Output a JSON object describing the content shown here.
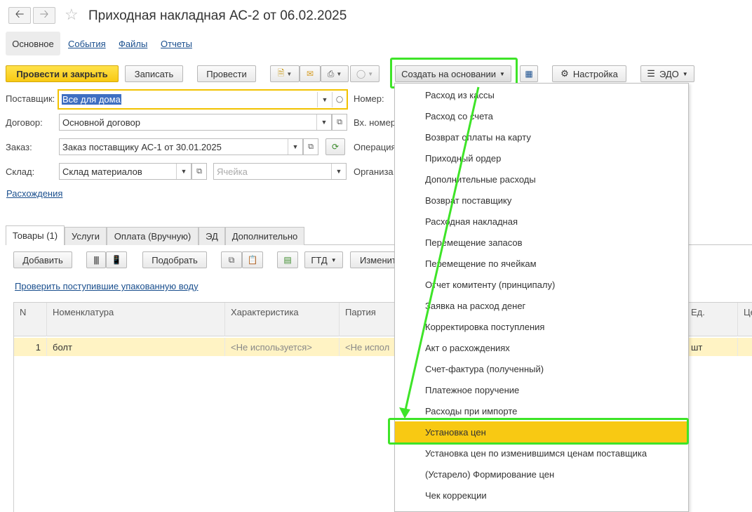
{
  "window": {
    "title": "Приходная накладная АС-2 от 06.02.2025"
  },
  "nav": {
    "back_icon": "arrow-left-icon",
    "forward_icon": "arrow-right-icon",
    "star_icon": "star-icon"
  },
  "top_tabs": [
    {
      "label": "Основное",
      "active": true
    },
    {
      "label": "События"
    },
    {
      "label": "Файлы"
    },
    {
      "label": "Отчеты"
    }
  ],
  "toolbar": {
    "post_close": "Провести и закрыть",
    "save": "Записать",
    "post": "Провести",
    "create_based": "Создать на основании",
    "settings": "Настройка",
    "edo": "ЭДО"
  },
  "form": {
    "supplier_label": "Поставщик:",
    "supplier_value": "Все для дома",
    "contract_label": "Договор:",
    "contract_value": "Основной договор",
    "order_label": "Заказ:",
    "order_value": "Заказ поставщику АС-1 от 30.01.2025",
    "warehouse_label": "Склад:",
    "warehouse_value": "Склад материалов",
    "cell_placeholder": "Ячейка",
    "number_label": "Номер:",
    "incoming_number_label": "Вх. номер",
    "operation_label": "Операция",
    "organization_label": "Организа",
    "discrepancies_link": "Расхождения"
  },
  "lower_tabs": [
    {
      "label": "Товары (1)",
      "active": true
    },
    {
      "label": "Услуги"
    },
    {
      "label": "Оплата (Вручную)"
    },
    {
      "label": "ЭД"
    },
    {
      "label": "Дополнительно"
    }
  ],
  "table_toolbar": {
    "add": "Добавить",
    "pick": "Подобрать",
    "gtd": "ГТД",
    "change": "Изменит"
  },
  "check_link": "Проверить поступившие упакованную воду",
  "table": {
    "columns": [
      "N",
      "Номенклатура",
      "Характеристика",
      "Партия",
      "Ед.",
      "Це"
    ],
    "rows": [
      {
        "n": "1",
        "item": "болт",
        "characteristic": "<Не используется>",
        "batch": "<Не испол",
        "unit": "шт"
      }
    ]
  },
  "menu_items": [
    "Расход из кассы",
    "Расход со счета",
    "Возврат оплаты на карту",
    "Приходный ордер",
    "Дополнительные расходы",
    "Возврат поставщику",
    "Расходная накладная",
    "Перемещение запасов",
    "Перемещение по ячейкам",
    "Отчет комитенту (принципалу)",
    "Заявка на расход денег",
    "Корректировка поступления",
    "Акт о расхождениях",
    "Счет-фактура (полученный)",
    "Платежное поручение",
    "Расходы при импорте",
    "Установка цен",
    "Установка цен по изменившимся ценам поставщика",
    "(Устарело) Формирование цен",
    "Чек коррекции"
  ],
  "menu_selected_index": 16,
  "colors": {
    "accent_yellow": "#f8c913",
    "highlight_green": "#3ee428",
    "link_blue": "#1a4f8e",
    "selected_row": "#fff3c4"
  }
}
